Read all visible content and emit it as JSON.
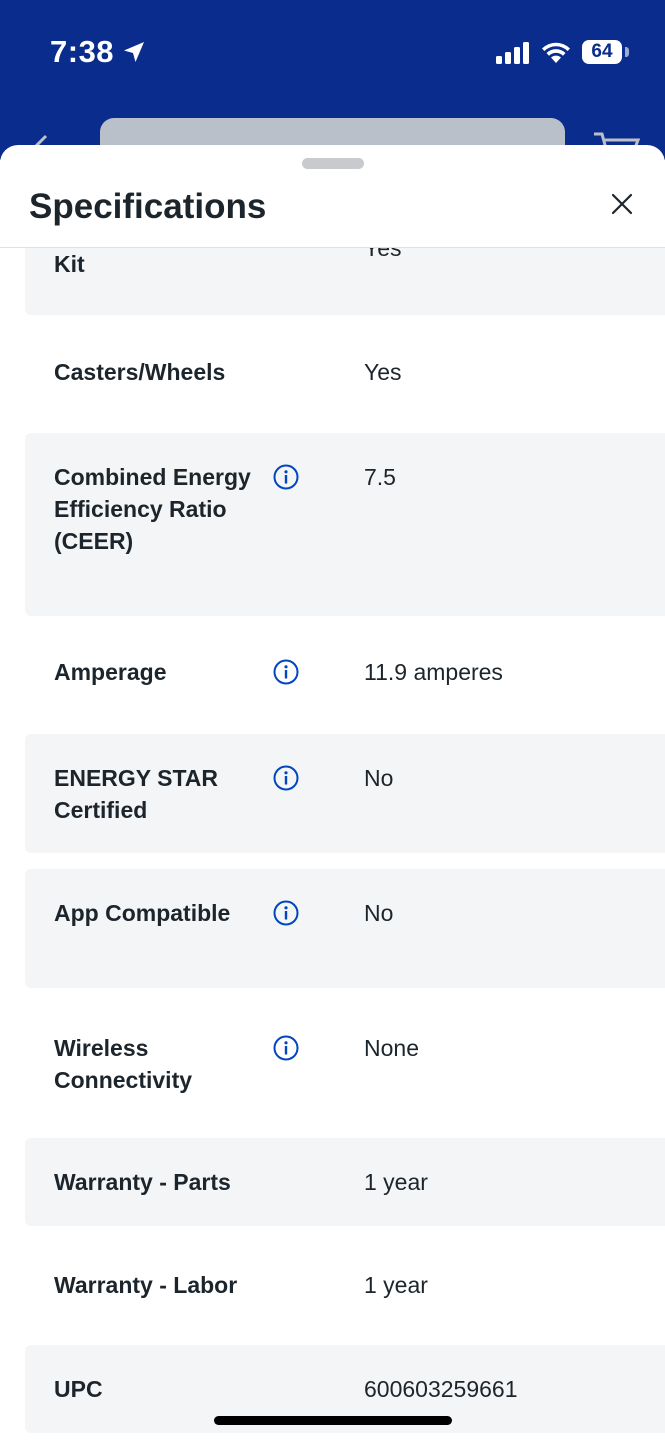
{
  "status_bar": {
    "time": "7:38",
    "battery": "64"
  },
  "sheet": {
    "title": "Specifications"
  },
  "specs": [
    {
      "label": "Window Venting Kit",
      "value": "Yes",
      "has_info": true
    },
    {
      "label": "Casters/Wheels",
      "value": "Yes",
      "has_info": false
    },
    {
      "label": "Combined Energy Efficiency Ratio (CEER)",
      "value": "7.5",
      "has_info": true
    },
    {
      "label": "Amperage",
      "value": "11.9 amperes",
      "has_info": true
    },
    {
      "label": "ENERGY STAR Certified",
      "value": "No",
      "has_info": true
    },
    {
      "label": "App Compatible",
      "value": "No",
      "has_info": true
    },
    {
      "label": "Wireless Connectivity",
      "value": "None",
      "has_info": true
    },
    {
      "label": "Warranty - Parts",
      "value": "1 year",
      "has_info": false
    },
    {
      "label": "Warranty - Labor",
      "value": "1 year",
      "has_info": false
    },
    {
      "label": "UPC",
      "value": "600603259661",
      "has_info": false
    }
  ],
  "colors": {
    "header_bg": "#0a2c8c",
    "info_icon": "#0046be",
    "row_shade": "#f4f5f7",
    "text": "#1d252c"
  },
  "icons": {
    "location": "location-arrow-icon",
    "signal": "cellular-signal-icon",
    "wifi": "wifi-icon",
    "close": "close-icon",
    "info": "info-icon"
  }
}
